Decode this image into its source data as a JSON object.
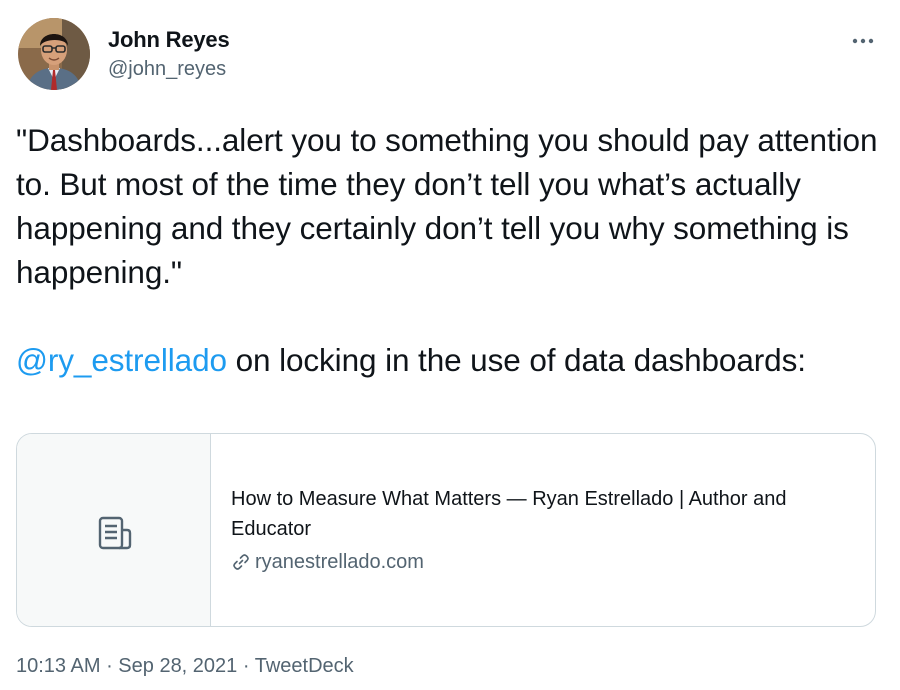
{
  "author": {
    "display_name": "John Reyes",
    "handle": "@john_reyes",
    "avatar_icon": "profile-photo"
  },
  "more_icon": "ellipsis-icon",
  "tweet": {
    "quote": "\"Dashboards...alert you to something you should pay attention to. But most of the time they don’t tell you what’s actually happening and they certainly don’t tell you why something is happening.\"",
    "mention": "@ry_estrellado",
    "rest": " on locking in the use of data dashboards:"
  },
  "card": {
    "title": "How to Measure What Matters — Ryan Estrellado | Author and Educator",
    "domain": "ryanestrellado.com",
    "thumb_icon": "article-icon",
    "link_icon": "link-icon"
  },
  "meta": {
    "time": "10:13 AM",
    "separator": " · ",
    "date": "Sep 28, 2021",
    "source": "TweetDeck"
  },
  "colors": {
    "accent": "#1d9bf0",
    "text": "#0f1419",
    "secondary": "#536471",
    "border": "#cfd9de",
    "card_thumb_bg": "#f7f9f9"
  }
}
